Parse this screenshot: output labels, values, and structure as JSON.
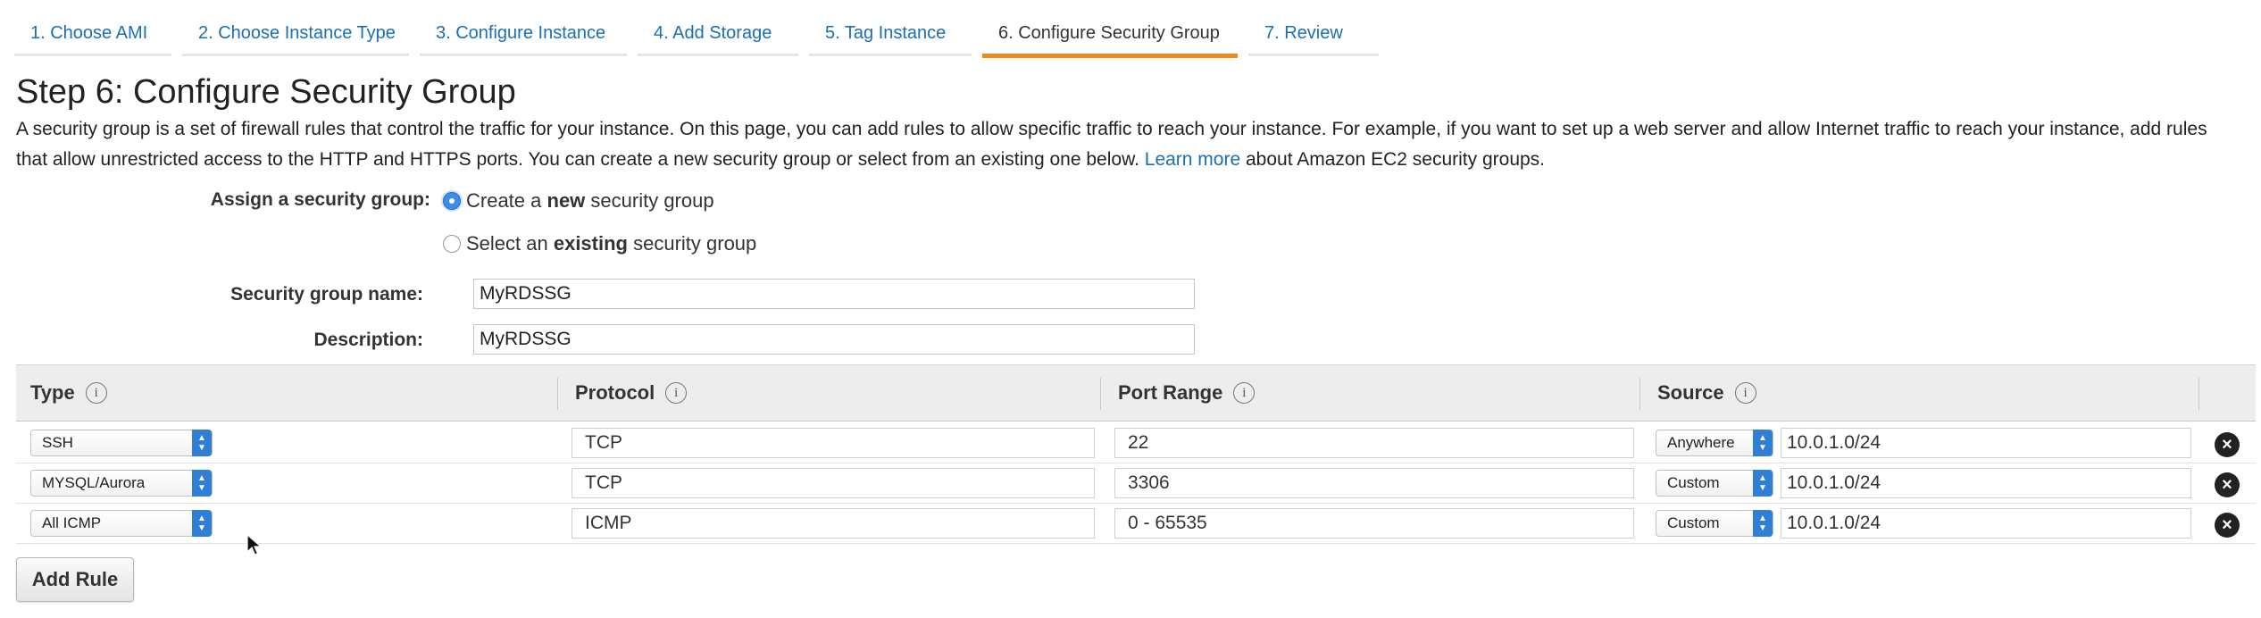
{
  "wizard": {
    "tabs": [
      {
        "label": "1. Choose AMI",
        "active": false
      },
      {
        "label": "2. Choose Instance Type",
        "active": false
      },
      {
        "label": "3. Configure Instance",
        "active": false
      },
      {
        "label": "4. Add Storage",
        "active": false
      },
      {
        "label": "5. Tag Instance",
        "active": false
      },
      {
        "label": "6. Configure Security Group",
        "active": true
      },
      {
        "label": "7. Review",
        "active": false
      }
    ]
  },
  "page": {
    "title": "Step 6: Configure Security Group",
    "description_start": "A security group is a set of firewall rules that control the traffic for your instance. On this page, you can add rules to allow specific traffic to reach your instance. For example, if you want to set up a web server and allow Internet traffic to reach your instance, add rules that allow unrestricted access to the HTTP and HTTPS ports. You can create a new security group or select from an existing one below.",
    "learn_more": "Learn more",
    "description_end": "about Amazon EC2 security groups."
  },
  "form": {
    "assign_label": "Assign a security group:",
    "option_new_pre": "Create a ",
    "option_new_bold": "new",
    "option_new_post": " security group",
    "option_existing_pre": "Select an ",
    "option_existing_bold": "existing",
    "option_existing_post": " security group",
    "selected_option": "new",
    "name_label": "Security group name:",
    "name_value": "MyRDSSG",
    "desc_label": "Description:",
    "desc_value": "MyRDSSG"
  },
  "rules_table": {
    "headers": {
      "type": "Type",
      "protocol": "Protocol",
      "port_range": "Port Range",
      "source": "Source"
    },
    "info_glyph": "i",
    "rows": [
      {
        "type": "SSH",
        "protocol": "TCP",
        "port_range": "22",
        "source_mode": "Anywhere",
        "source_cidr": "10.0.1.0/24"
      },
      {
        "type": "MYSQL/Aurora",
        "protocol": "TCP",
        "port_range": "3306",
        "source_mode": "Custom",
        "source_cidr": "10.0.1.0/24"
      },
      {
        "type": "All ICMP",
        "protocol": "ICMP",
        "port_range": "0 - 65535",
        "source_mode": "Custom",
        "source_cidr": "10.0.1.0/24"
      }
    ]
  },
  "actions": {
    "add_rule": "Add Rule"
  },
  "icons": {
    "info": "info-icon",
    "remove": "remove-circle-icon",
    "select_arrow": "updown-arrow-icon",
    "cursor": "mouse-pointer-icon"
  },
  "colors": {
    "link": "#1a6fb5",
    "active_tab_underline": "#ec8b15",
    "radio_selected": "#3a8ee6",
    "select_arrow": "#2f7fd6",
    "table_header_bg": "#ededed"
  }
}
